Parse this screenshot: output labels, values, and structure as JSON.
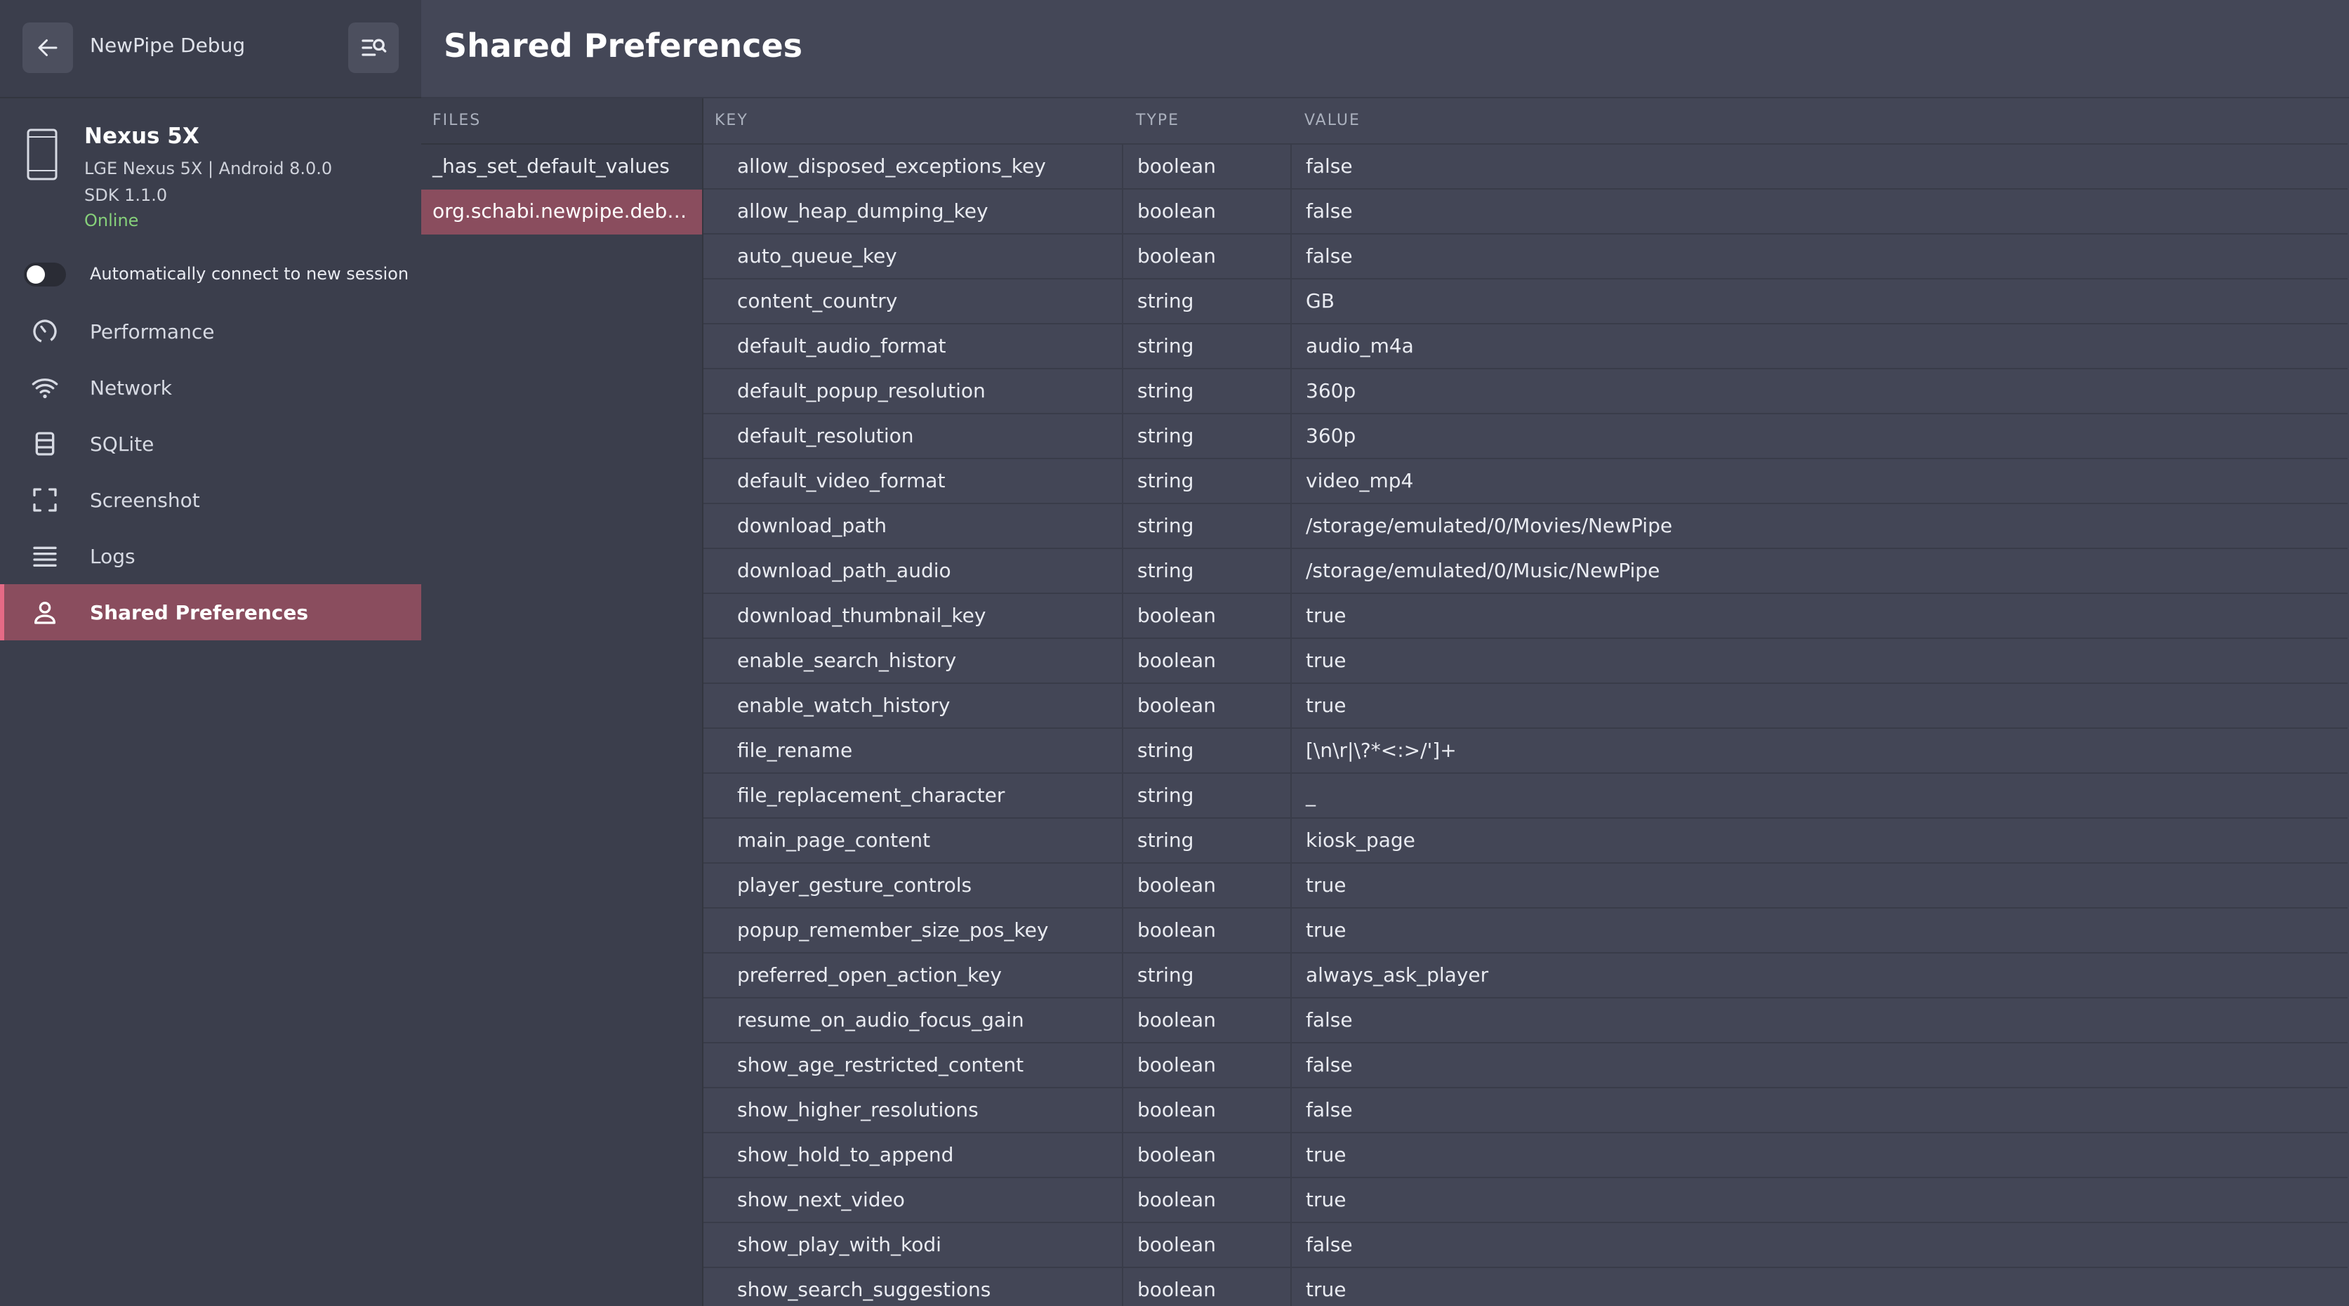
{
  "window": {
    "app_title": "NewPipe Debug"
  },
  "device": {
    "name": "Nexus 5X",
    "model": "LGE Nexus 5X | Android 8.0.0",
    "sdk": "SDK 1.1.0",
    "status": "Online"
  },
  "auto_connect": {
    "label": "Automatically connect to new session",
    "enabled": false
  },
  "nav": {
    "items": [
      {
        "label": "Performance",
        "icon": "gauge-icon",
        "active": false
      },
      {
        "label": "Network",
        "icon": "wifi-icon",
        "active": false
      },
      {
        "label": "SQLite",
        "icon": "database-icon",
        "active": false
      },
      {
        "label": "Screenshot",
        "icon": "screenshot-icon",
        "active": false
      },
      {
        "label": "Logs",
        "icon": "list-icon",
        "active": false
      },
      {
        "label": "Shared Preferences",
        "icon": "person-icon",
        "active": true
      }
    ]
  },
  "page": {
    "title": "Shared Preferences"
  },
  "files": {
    "header": "FILES",
    "items": [
      {
        "label": "_has_set_default_values",
        "selected": false
      },
      {
        "label": "org.schabi.newpipe.debug_preferences",
        "selected": true
      }
    ]
  },
  "table": {
    "headers": {
      "key": "KEY",
      "type": "TYPE",
      "value": "VALUE"
    },
    "rows": [
      {
        "key": "allow_disposed_exceptions_key",
        "type": "boolean",
        "value": "false"
      },
      {
        "key": "allow_heap_dumping_key",
        "type": "boolean",
        "value": "false"
      },
      {
        "key": "auto_queue_key",
        "type": "boolean",
        "value": "false"
      },
      {
        "key": "content_country",
        "type": "string",
        "value": "GB"
      },
      {
        "key": "default_audio_format",
        "type": "string",
        "value": "audio_m4a"
      },
      {
        "key": "default_popup_resolution",
        "type": "string",
        "value": "360p"
      },
      {
        "key": "default_resolution",
        "type": "string",
        "value": "360p"
      },
      {
        "key": "default_video_format",
        "type": "string",
        "value": "video_mp4"
      },
      {
        "key": "download_path",
        "type": "string",
        "value": "/storage/emulated/0/Movies/NewPipe"
      },
      {
        "key": "download_path_audio",
        "type": "string",
        "value": "/storage/emulated/0/Music/NewPipe"
      },
      {
        "key": "download_thumbnail_key",
        "type": "boolean",
        "value": "true"
      },
      {
        "key": "enable_search_history",
        "type": "boolean",
        "value": "true"
      },
      {
        "key": "enable_watch_history",
        "type": "boolean",
        "value": "true"
      },
      {
        "key": "file_rename",
        "type": "string",
        "value": "[\\n\\r|\\?*<:>/']+"
      },
      {
        "key": "file_replacement_character",
        "type": "string",
        "value": "_"
      },
      {
        "key": "main_page_content",
        "type": "string",
        "value": "kiosk_page"
      },
      {
        "key": "player_gesture_controls",
        "type": "boolean",
        "value": "true"
      },
      {
        "key": "popup_remember_size_pos_key",
        "type": "boolean",
        "value": "true"
      },
      {
        "key": "preferred_open_action_key",
        "type": "string",
        "value": "always_ask_player"
      },
      {
        "key": "resume_on_audio_focus_gain",
        "type": "boolean",
        "value": "false"
      },
      {
        "key": "show_age_restricted_content",
        "type": "boolean",
        "value": "false"
      },
      {
        "key": "show_higher_resolutions",
        "type": "boolean",
        "value": "false"
      },
      {
        "key": "show_hold_to_append",
        "type": "boolean",
        "value": "true"
      },
      {
        "key": "show_next_video",
        "type": "boolean",
        "value": "true"
      },
      {
        "key": "show_play_with_kodi",
        "type": "boolean",
        "value": "false"
      },
      {
        "key": "show_search_suggestions",
        "type": "boolean",
        "value": "true"
      }
    ]
  },
  "colors": {
    "sidebar_bg": "#3b3e4c",
    "main_bg": "#434656",
    "accent": "#8a4d5e",
    "accent_bar": "#e56a86",
    "online": "#86d07a"
  }
}
